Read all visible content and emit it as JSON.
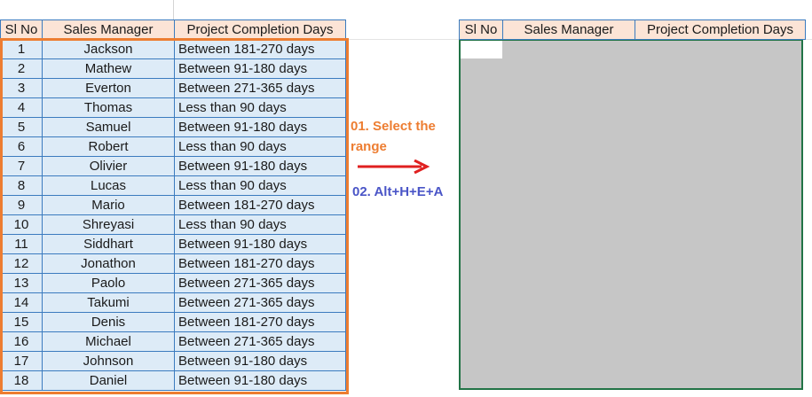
{
  "source_table": {
    "headers": [
      "Sl No",
      "Sales Manager",
      "Project Completion Days"
    ],
    "rows": [
      [
        "1",
        "Jackson",
        "Between 181-270 days"
      ],
      [
        "2",
        "Mathew",
        "Between 91-180 days"
      ],
      [
        "3",
        "Everton",
        "Between 271-365 days"
      ],
      [
        "4",
        "Thomas",
        "Less than 90 days"
      ],
      [
        "5",
        "Samuel",
        "Between 91-180 days"
      ],
      [
        "6",
        "Robert",
        "Less than 90 days"
      ],
      [
        "7",
        "Olivier",
        "Between 91-180 days"
      ],
      [
        "8",
        "Lucas",
        "Less than 90 days"
      ],
      [
        "9",
        "Mario",
        "Between 181-270 days"
      ],
      [
        "10",
        "Shreyasi",
        "Less than 90 days"
      ],
      [
        "11",
        "Siddhart",
        "Between 91-180 days"
      ],
      [
        "12",
        "Jonathon",
        "Between 181-270 days"
      ],
      [
        "13",
        "Paolo",
        "Between 271-365 days"
      ],
      [
        "14",
        "Takumi",
        "Between 271-365 days"
      ],
      [
        "15",
        "Denis",
        "Between 181-270 days"
      ],
      [
        "16",
        "Michael",
        "Between 271-365 days"
      ],
      [
        "17",
        "Johnson",
        "Between 91-180 days"
      ],
      [
        "18",
        "Daniel",
        "Between 91-180 days"
      ]
    ]
  },
  "target_table": {
    "headers": [
      "Sl No",
      "Sales Manager",
      "Project Completion Days"
    ]
  },
  "annotations": {
    "step1": "01. Select the range",
    "step2": "02. Alt+H+E+A"
  },
  "colors": {
    "header_fill": "#fce4d6",
    "cell_fill": "#ddebf7",
    "border_blue": "#3b7bbf",
    "selection_orange": "#ed7d31",
    "arrow_red": "#e02020",
    "step2_blue": "#4a55c7",
    "cleared_gray": "#c6c6c6",
    "excel_green": "#217346"
  },
  "icons": [
    "arrow-right-icon"
  ]
}
